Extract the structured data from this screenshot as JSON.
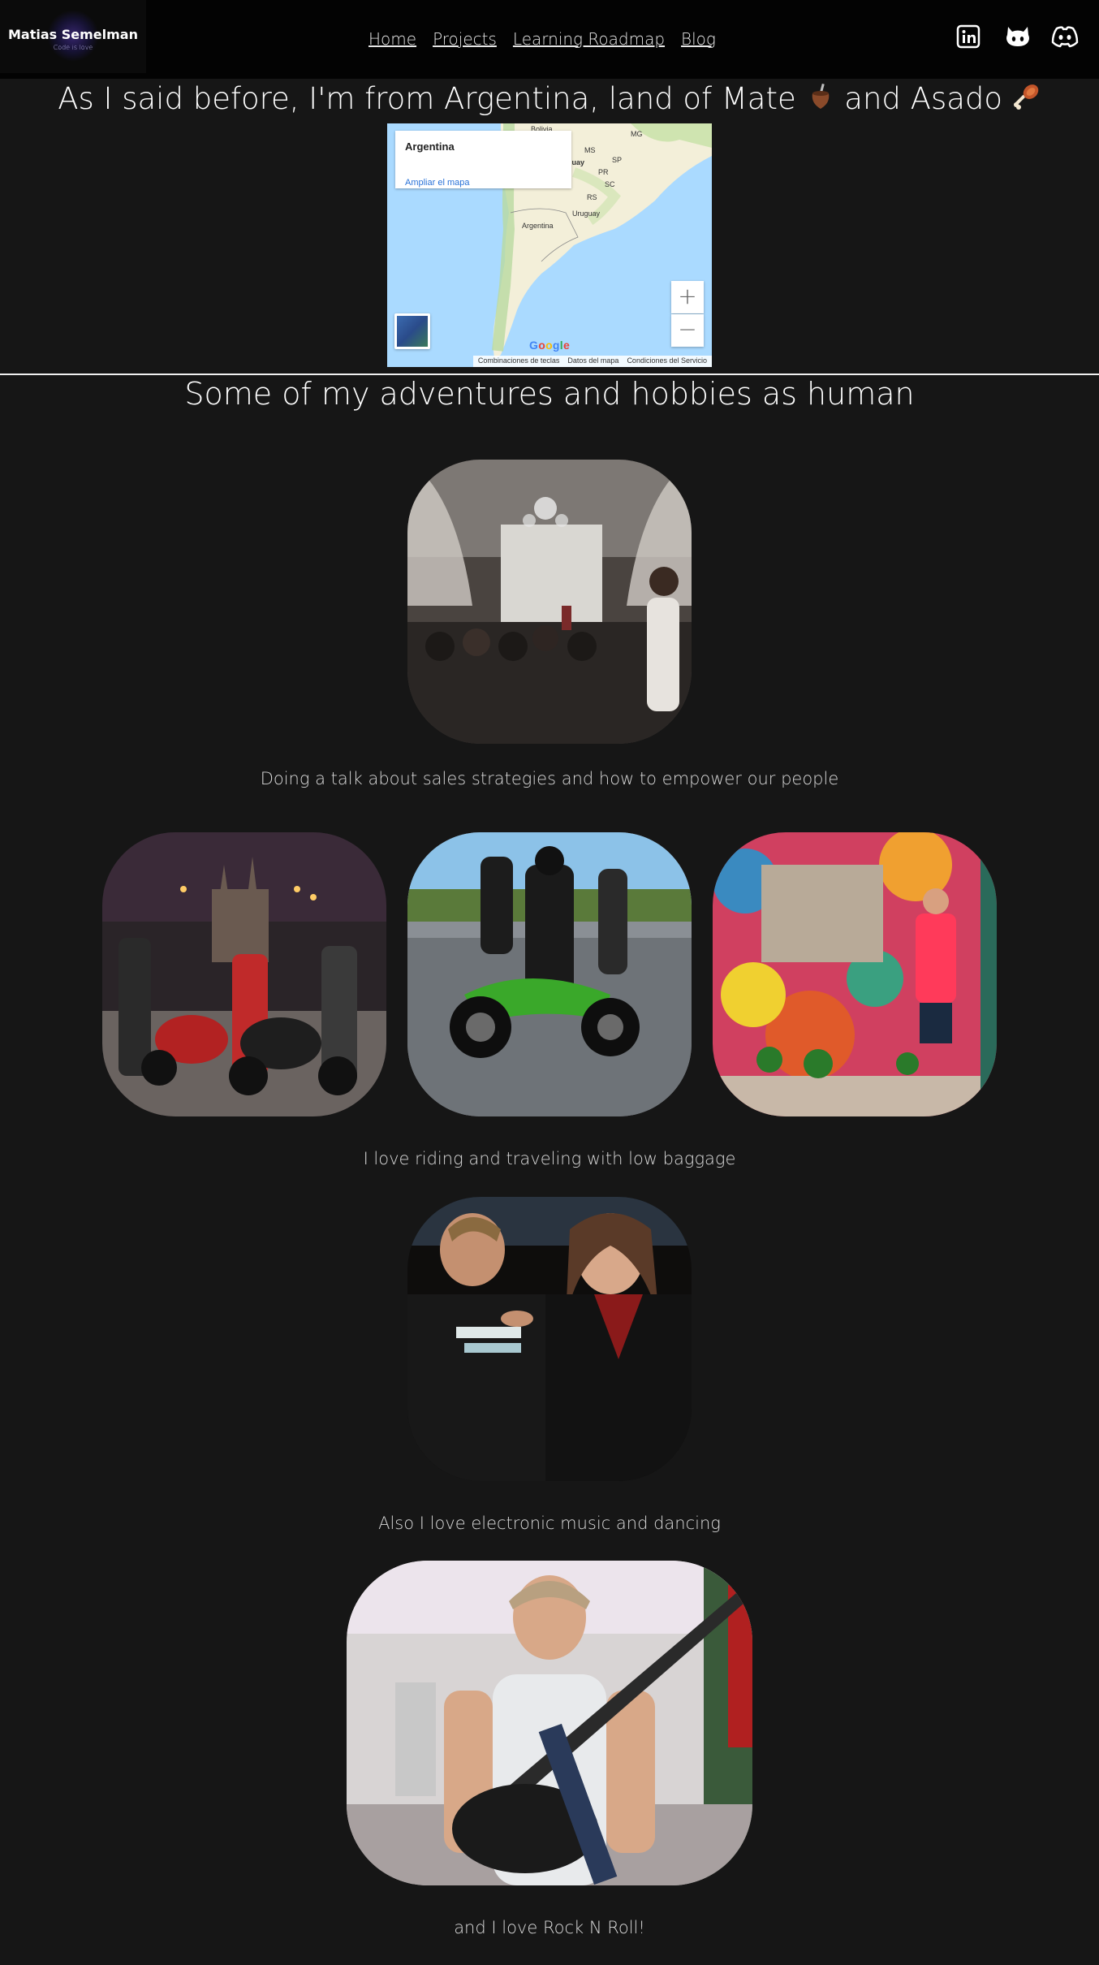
{
  "header": {
    "logo": {
      "name": "Matias Semelman",
      "tagline": "Code is love"
    },
    "nav": [
      {
        "label": "Home"
      },
      {
        "label": "Projects"
      },
      {
        "label": "Learning Roadmap"
      },
      {
        "label": "Blog"
      }
    ],
    "social": [
      "linkedin-icon",
      "github-icon",
      "discord-icon"
    ]
  },
  "location_section": {
    "title": "As I said before, I'm from Argentina, land of Mate",
    "title_and": "and Asado",
    "map": {
      "place_name": "Argentina",
      "enlarge_link": "Ampliar el mapa",
      "zoom_in": "+",
      "zoom_out": "−",
      "google": "Google",
      "attribution": [
        "Combinaciones de teclas",
        "Datos del mapa",
        "Condiciones del Servicio"
      ],
      "labels": {
        "country": "Argentina",
        "uruguay": "Uruguay",
        "bolivia": "Bolivia",
        "paraguay": "aguay",
        "mg": "MG",
        "ms": "MS",
        "sp": "SP",
        "pr": "PR",
        "sc": "SC",
        "rs": "RS"
      }
    }
  },
  "hobbies_section": {
    "title": "Some of my adventures and hobbies as human",
    "captions": {
      "talk": "Doing a talk about sales strategies and how to empower our people",
      "riding": "I love riding and traveling with low baggage",
      "music": "Also I love electronic music and dancing",
      "rock": "and I love Rock N Roll!"
    }
  },
  "colors": {
    "background": "#161616",
    "header": "#030303",
    "text": "#ffffff",
    "link": "#2a73d8"
  }
}
